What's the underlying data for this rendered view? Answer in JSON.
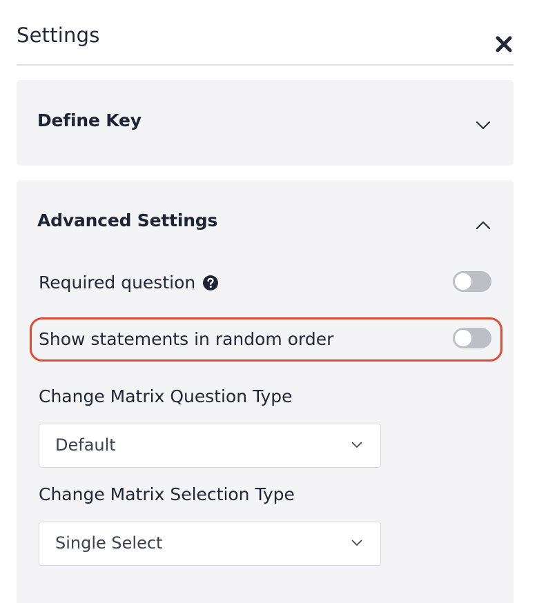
{
  "header": {
    "title": "Settings",
    "close_icon": "close-icon"
  },
  "panels": {
    "define_key": {
      "title": "Define Key",
      "expanded": false
    },
    "advanced": {
      "title": "Advanced Settings",
      "expanded": true,
      "required_question": {
        "label": "Required question",
        "enabled": false
      },
      "random_order": {
        "label": "Show statements in random order",
        "enabled": false,
        "highlighted": true
      },
      "matrix_question_type": {
        "label": "Change Matrix Question Type",
        "value": "Default"
      },
      "matrix_selection_type": {
        "label": "Change Matrix Selection Type",
        "value": "Single Select"
      }
    }
  },
  "colors": {
    "panel_bg": "#f4f4f7",
    "toggle_off": "#bdbfc6",
    "highlight": "#e04a34",
    "text": "#222836"
  }
}
